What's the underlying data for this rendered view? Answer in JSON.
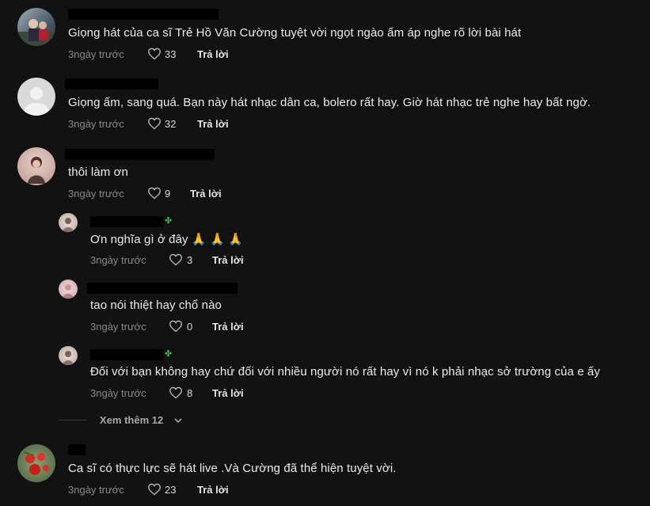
{
  "comments": [
    {
      "text": "Giọng hát của ca sĩ Trẻ Hồ Văn Cường tuyệt vời ngọt ngào ấm áp nghe rõ lời bài hát",
      "time": "3ngày trước",
      "likes": "33",
      "reply": "Trả lời"
    },
    {
      "text": "Giọng ấm, sang quá. Bạn này hát nhạc dân ca, bolero rất hay. Giờ hát nhạc trẻ nghe hay bất ngờ.",
      "time": "3ngày trước",
      "likes": "32",
      "reply": "Trả lời"
    },
    {
      "text": "thôi làm ơn",
      "time": "3ngày trước",
      "likes": "9",
      "reply": "Trả lời"
    },
    {
      "text": "Ơn nghĩa gì ở đây 🙏 🙏 🙏",
      "time": "3ngày trước",
      "likes": "3",
      "reply": "Trả lời"
    },
    {
      "text": "tao nói thiệt hay chổ nào",
      "time": "3ngày trước",
      "likes": "0",
      "reply": "Trả lời"
    },
    {
      "text": "Đối với bạn không hay chứ đối với nhiều người nó rất hay vì nó k phải nhạc sở trường của e ấy",
      "time": "3ngày trước",
      "likes": "8",
      "reply": "Trả lời"
    },
    {
      "text": "Ca sĩ có thực lực sẽ hát live .Và Cường đã thể hiện tuyệt vời.",
      "time": "3ngày trước",
      "likes": "23",
      "reply": "Trả lời"
    }
  ],
  "view_more": "Xem thêm 12",
  "colors": {
    "background": "#121212",
    "muted": "#8a8a8a",
    "clover": "#3fb950"
  }
}
